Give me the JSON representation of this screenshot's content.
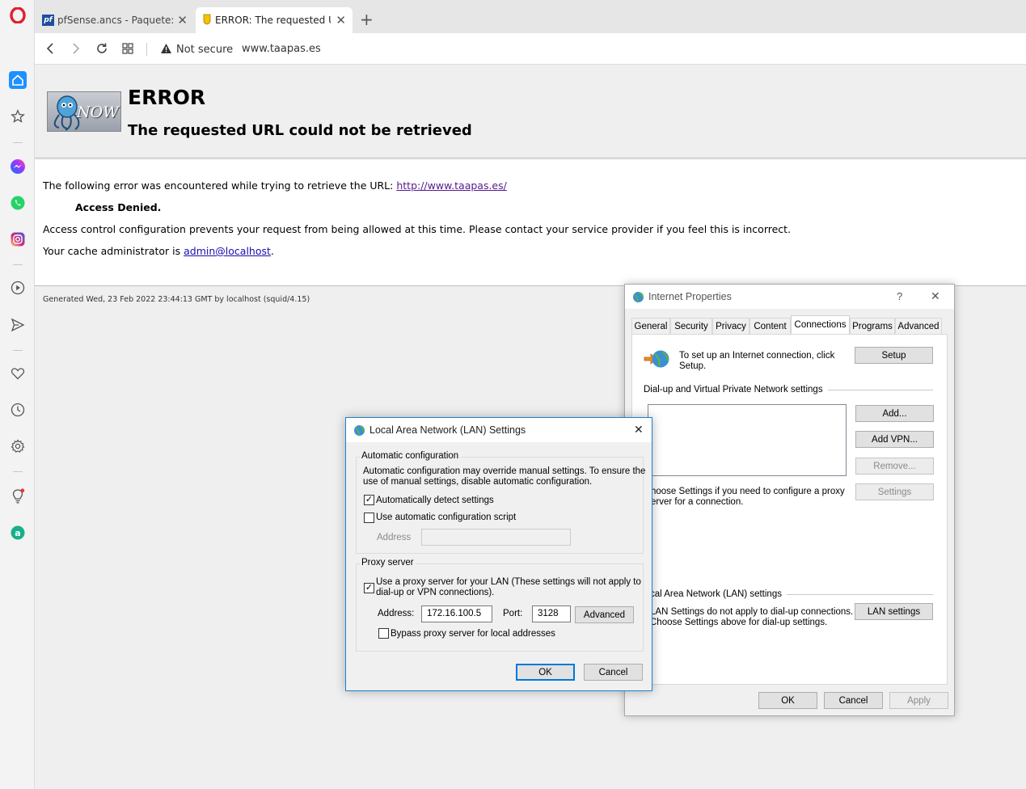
{
  "browser": {
    "tabs": [
      {
        "label": "pfSense.ancs - Paquete: Pr",
        "favicon": "pf"
      },
      {
        "label": "ERROR: The requested URL",
        "favicon": "squid-icon"
      }
    ],
    "nav": {
      "not_secure": "Not secure",
      "url": "www.taapas.es"
    }
  },
  "page": {
    "title": "ERROR",
    "subtitle": "The requested URL could not be retrieved",
    "logo_text": "NOW",
    "line1_prefix": "The following error was encountered while trying to retrieve the URL: ",
    "line1_link": "http://www.taapas.es/",
    "access_denied": "Access Denied.",
    "line2": "Access control configuration prevents your request from being allowed at this time. Please contact your service provider if you feel this is incorrect.",
    "line3_prefix": "Your cache administrator is ",
    "line3_link": "admin@localhost",
    "line3_suffix": ".",
    "footer": "Generated Wed, 23 Feb 2022 23:44:13 GMT by localhost (squid/4.15)"
  },
  "inet": {
    "title": "Internet Properties",
    "help": "?",
    "close": "✕",
    "tabs": [
      "General",
      "Security",
      "Privacy",
      "Content",
      "Connections",
      "Programs",
      "Advanced"
    ],
    "setup_text_1": "To set up an Internet connection, click",
    "setup_text_2": "Setup.",
    "setup_btn": "Setup",
    "dialup_label": "Dial-up and Virtual Private Network settings",
    "add_btn": "Add...",
    "addvpn_btn": "Add VPN...",
    "remove_btn": "Remove...",
    "settings_btn": "Settings",
    "choose_1": "hoose Settings if you need to configure a proxy",
    "choose_2": "erver for a connection.",
    "lan_label": "cal Area Network (LAN) settings",
    "lan_text_1": "LAN Settings do not apply to dial-up connections.",
    "lan_text_2": "Choose Settings above for dial-up settings.",
    "lan_btn": "LAN settings",
    "ok": "OK",
    "cancel": "Cancel",
    "apply": "Apply"
  },
  "lan": {
    "title": "Local Area Network (LAN) Settings",
    "close": "✕",
    "auto_legend": "Automatic configuration",
    "auto_text_1": "Automatic configuration may override manual settings.  To ensure the",
    "auto_text_2": "use of manual settings, disable automatic configuration.",
    "auto_detect": "Automatically detect settings",
    "auto_detect_checked": true,
    "auto_script": "Use automatic configuration script",
    "auto_script_checked": false,
    "address_label": "Address",
    "address_value": "",
    "proxy_legend": "Proxy server",
    "use_proxy_1": "Use a proxy server for your LAN (These settings will not apply to",
    "use_proxy_2": "dial-up or VPN connections).",
    "use_proxy_checked": true,
    "proxy_address_label": "Address:",
    "proxy_address": "172.16.100.5",
    "port_label": "Port:",
    "port": "3128",
    "advanced_btn": "Advanced",
    "bypass": "Bypass proxy server for local addresses",
    "bypass_checked": false,
    "ok": "OK",
    "cancel": "Cancel"
  },
  "sidebar": {
    "icons": [
      "opera-logo-icon",
      "home-icon",
      "speed-dial-star-icon",
      "messenger-icon",
      "whatsapp-icon",
      "instagram-icon",
      "player-icon",
      "send-icon",
      "heart-icon",
      "history-clock-icon",
      "settings-gear-icon",
      "lightbulb-icon",
      "aria-icon"
    ]
  }
}
